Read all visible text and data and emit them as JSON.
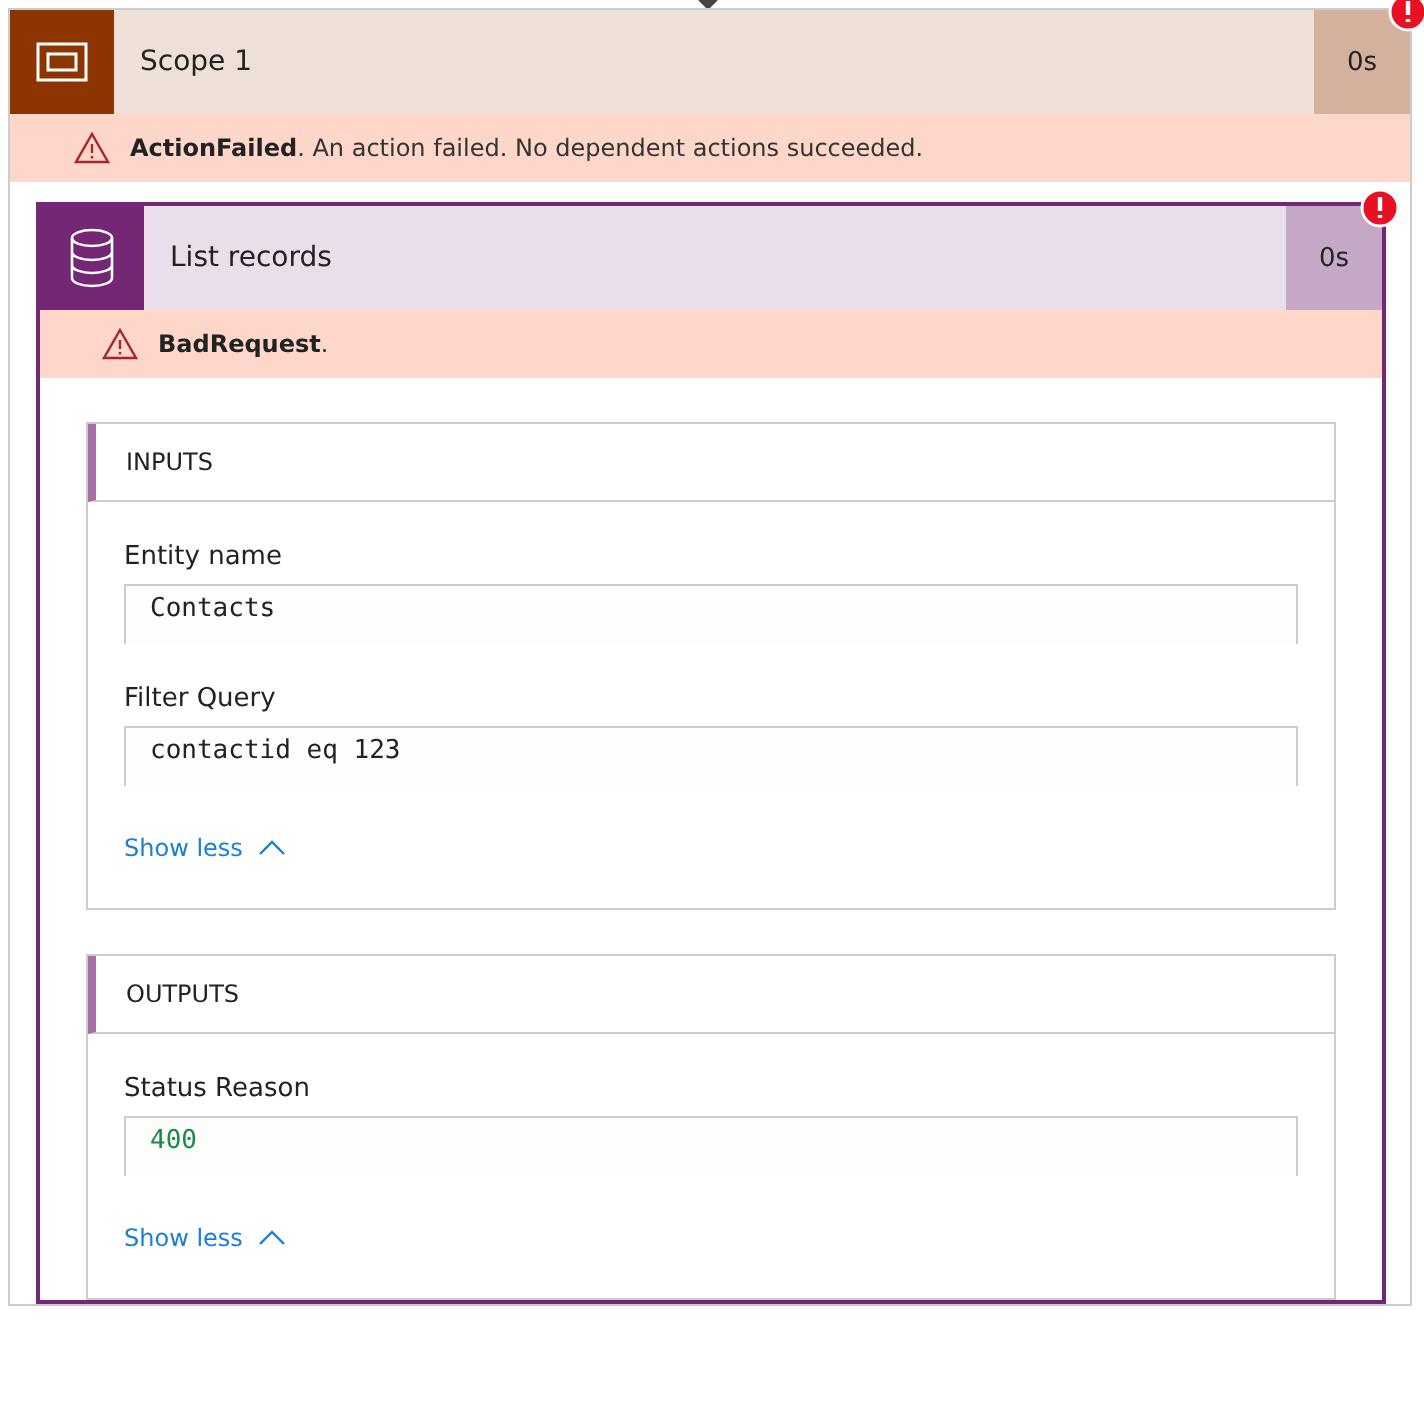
{
  "scope": {
    "title": "Scope 1",
    "duration": "0s",
    "failed": true,
    "error": "**ActionFailed**. An action failed. No dependent actions succeeded.",
    "action": {
      "title": "List records",
      "duration": "0s",
      "failed": true,
      "error": "**BadRequest**.",
      "sections": [
        {
          "title": "INPUTS",
          "fields": [
            {
              "label": "Entity name",
              "value": "Contacts",
              "kind": "string"
            },
            {
              "label": "Filter Query",
              "value": "contactid eq 123",
              "kind": "string"
            }
          ],
          "toggle": "Show less",
          "expanded": true
        },
        {
          "title": "OUTPUTS",
          "fields": [
            {
              "label": "Status Reason",
              "value": "400",
              "kind": "number"
            }
          ],
          "toggle": "Show less",
          "expanded": true
        }
      ]
    }
  }
}
